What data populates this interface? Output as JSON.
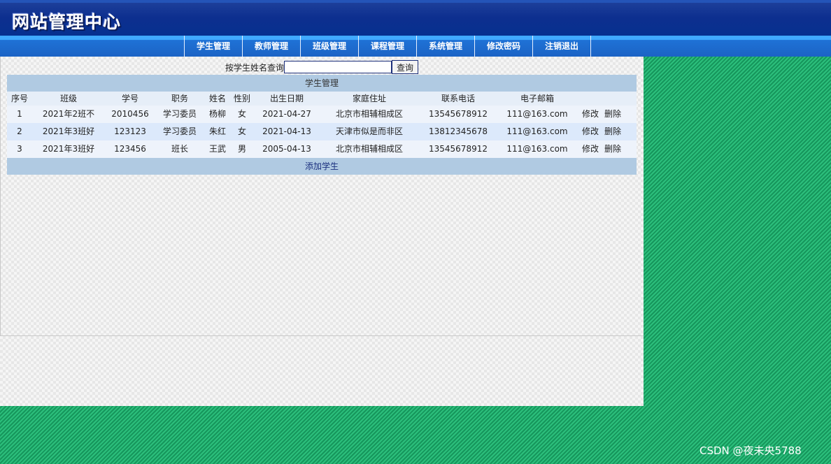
{
  "header": {
    "title": "网站管理中心"
  },
  "nav": {
    "items": [
      "学生管理",
      "教师管理",
      "班级管理",
      "课程管理",
      "系统管理",
      "修改密码",
      "注销退出"
    ]
  },
  "search": {
    "label": "按学生姓名查询",
    "value": "",
    "button": "查询"
  },
  "table": {
    "title": "学生管理",
    "columns": [
      "序号",
      "班级",
      "学号",
      "职务",
      "姓名",
      "性别",
      "出生日期",
      "家庭住址",
      "联系电话",
      "电子邮箱"
    ],
    "rows": [
      [
        "1",
        "2021年2班不",
        "2010456",
        "学习委员",
        "杨柳",
        "女",
        "2021-04-27",
        "北京市相辅相成区",
        "13545678912",
        "111@163.com"
      ],
      [
        "2",
        "2021年3班好",
        "123123",
        "学习委员",
        "朱红",
        "女",
        "2021-04-13",
        "天津市似是而非区",
        "13812345678",
        "111@163.com"
      ],
      [
        "3",
        "2021年3班好",
        "123456",
        "班长",
        "王武",
        "男",
        "2005-04-13",
        "北京市相辅相成区",
        "13545678912",
        "111@163.com"
      ]
    ],
    "actions": {
      "edit": "修改",
      "delete": "删除"
    },
    "add_label": "添加学生"
  },
  "watermark": "CSDN @夜未央5788",
  "colors": {
    "header_bg": "#06308f",
    "nav_bg": "#1b63c5",
    "table_title_bg": "#b0cae2",
    "page_bg": "#1fa56a"
  }
}
